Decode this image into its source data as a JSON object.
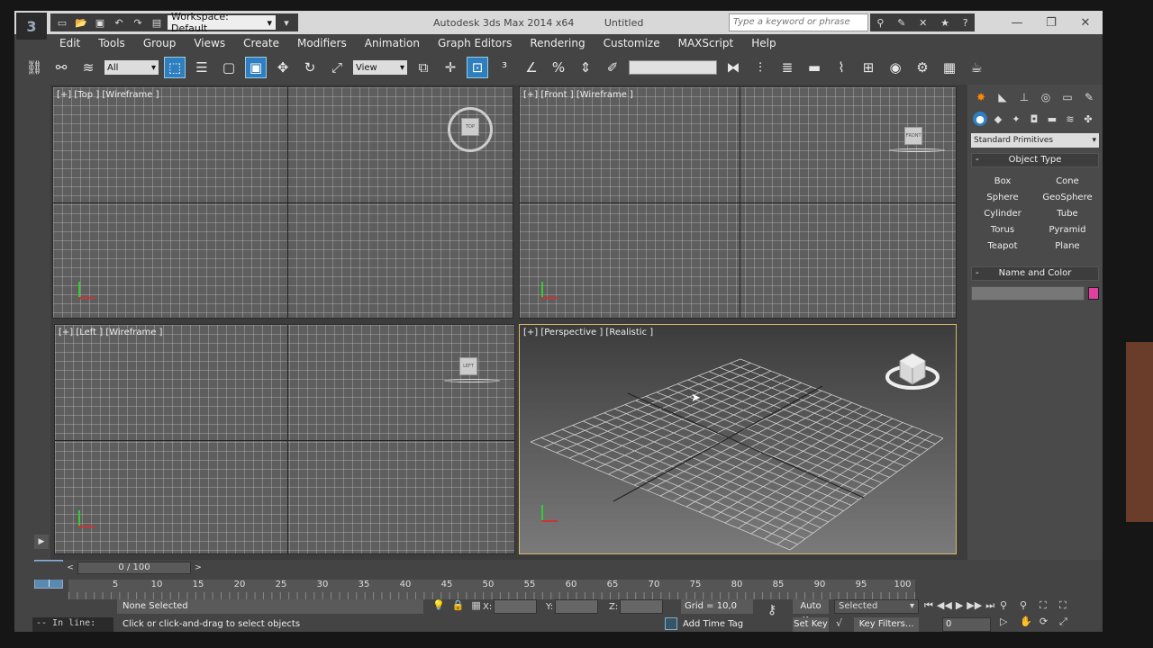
{
  "titlebar": {
    "workspace": "Workspace: Default",
    "app_title": "Autodesk 3ds Max  2014 x64",
    "doc_title": "Untitled",
    "search_placeholder": "Type a keyword or phrase"
  },
  "menu": [
    "Edit",
    "Tools",
    "Group",
    "Views",
    "Create",
    "Modifiers",
    "Animation",
    "Graph Editors",
    "Rendering",
    "Customize",
    "MAXScript",
    "Help"
  ],
  "toolbar": {
    "selection_filter": "All",
    "ref_coord": "View"
  },
  "viewports": {
    "top": {
      "label": "[+] [Top ] [Wireframe ]",
      "cube": "TOP"
    },
    "front": {
      "label": "[+] [Front ] [Wireframe ]",
      "cube": "FRONT"
    },
    "left": {
      "label": "[+] [Left ] [Wireframe ]",
      "cube": "LEFT"
    },
    "perspective": {
      "label": "[+] [Perspective ] [Realistic ]"
    }
  },
  "command_panel": {
    "category": "Standard Primitives",
    "object_type_title": "Object Type",
    "objects": [
      "Box",
      "Cone",
      "Sphere",
      "GeoSphere",
      "Cylinder",
      "Tube",
      "Torus",
      "Pyramid",
      "Teapot",
      "Plane"
    ],
    "name_color_title": "Name and Color",
    "swatch_color": "#e040a0"
  },
  "timeline": {
    "slider": "0 / 100",
    "ticks": [
      "5",
      "10",
      "15",
      "20",
      "25",
      "30",
      "35",
      "40",
      "45",
      "50",
      "55",
      "60",
      "65",
      "70",
      "75",
      "80",
      "85",
      "90",
      "95",
      "100"
    ]
  },
  "status": {
    "script_listener": "-- In line:",
    "selection": "None Selected",
    "prompt": "Click or click-and-drag to select objects",
    "x_label": "X:",
    "y_label": "Y:",
    "z_label": "Z:",
    "grid": "Grid = 10,0",
    "add_time_tag": "Add Time Tag",
    "auto_key": "Auto Key",
    "set_key": "Set Key",
    "selected": "Selected",
    "key_filters": "Key Filters...",
    "frame": "0"
  }
}
